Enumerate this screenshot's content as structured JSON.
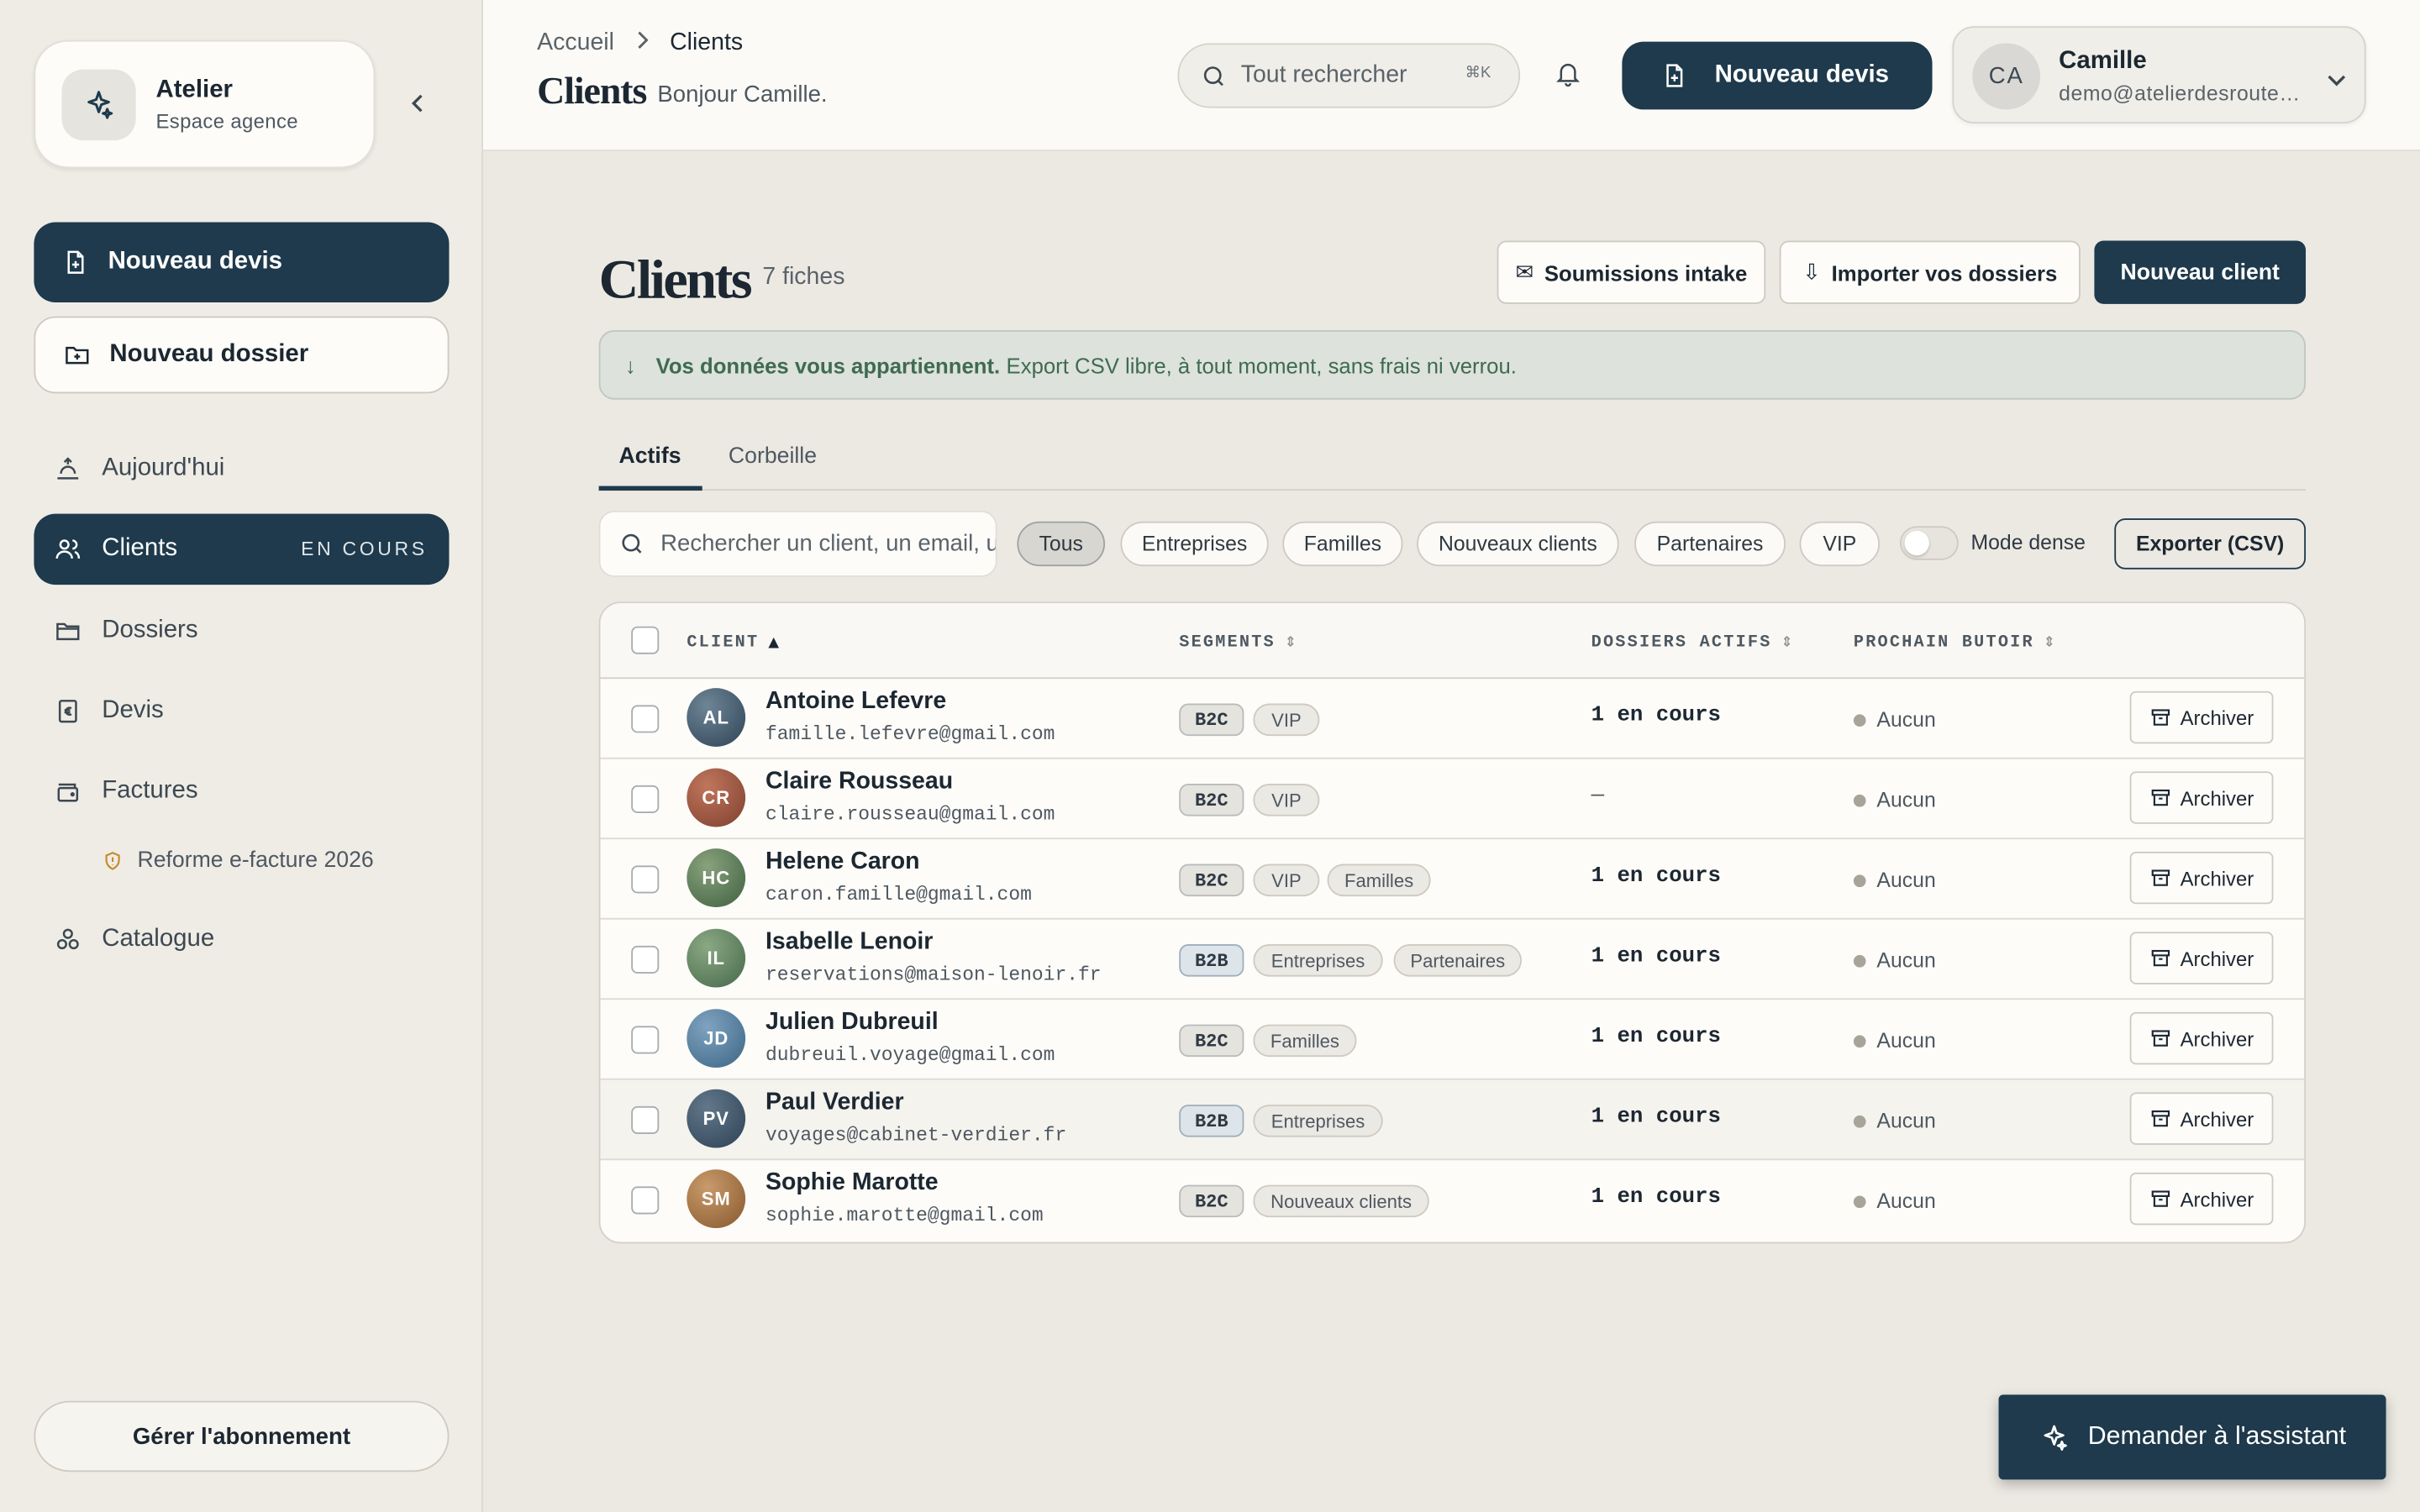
{
  "colors": {
    "accent": "#1e3a4c",
    "notice_bg": "#dde2dc",
    "notice_text": "#3f6b51",
    "background": "#ece9e3"
  },
  "sidebar": {
    "brand_name": "Atelier",
    "brand_sub": "Espace agence",
    "new_quote": "Nouveau devis",
    "new_folder": "Nouveau dossier",
    "nav": {
      "today": "Aujourd'hui",
      "clients": "Clients",
      "clients_badge": "EN COURS",
      "folders": "Dossiers",
      "quotes": "Devis",
      "invoices": "Factures",
      "reform": "Reforme e-facture 2026",
      "catalog": "Catalogue"
    },
    "subscription": "Gérer l'abonnement"
  },
  "header": {
    "crumb_home": "Accueil",
    "crumb_current": "Clients",
    "title": "Clients",
    "greeting": "Bonjour Camille.",
    "search_placeholder": "Tout rechercher",
    "search_shortcut": "⌘K",
    "new_quote": "Nouveau devis",
    "user_initials": "CA",
    "user_name": "Camille",
    "user_email": "demo@atelierdesroutes.fr"
  },
  "main": {
    "title": "Clients",
    "count": "7 fiches",
    "btn_intake": "Soumissions intake",
    "btn_import": "Importer vos dossiers",
    "btn_new_client": "Nouveau client",
    "notice_bold": "Vos données vous appartiennent.",
    "notice_text": "Export CSV libre, à tout moment, sans frais ni verrou.",
    "tabs": {
      "active": "Actifs",
      "trash": "Corbeille"
    },
    "filter_placeholder": "Rechercher un client, un email, un téléphone",
    "chips": [
      "Tous",
      "Entreprises",
      "Familles",
      "Nouveaux clients",
      "Partenaires",
      "VIP"
    ],
    "dense_label": "Mode dense",
    "export": "Exporter (CSV)"
  },
  "table": {
    "headers": {
      "client": "CLIENT",
      "segments": "SEGMENTS",
      "folders": "DOSSIERS ACTIFS",
      "due": "PROCHAIN BUTOIR"
    },
    "archive_label": "Archiver",
    "rows": [
      {
        "initials": "AL",
        "name": "Antoine Lefevre",
        "email": "famille.lefevre@gmail.com",
        "type": "B2C",
        "segments": [
          "VIP"
        ],
        "folders": "1 en cours",
        "due": "Aucun"
      },
      {
        "initials": "CR",
        "name": "Claire Rousseau",
        "email": "claire.rousseau@gmail.com",
        "type": "B2C",
        "segments": [
          "VIP"
        ],
        "folders": "—",
        "due": "Aucun"
      },
      {
        "initials": "HC",
        "name": "Helene Caron",
        "email": "caron.famille@gmail.com",
        "type": "B2C",
        "segments": [
          "VIP",
          "Familles"
        ],
        "folders": "1 en cours",
        "due": "Aucun"
      },
      {
        "initials": "IL",
        "name": "Isabelle Lenoir",
        "email": "reservations@maison-lenoir.fr",
        "type": "B2B",
        "segments": [
          "Entreprises",
          "Partenaires"
        ],
        "folders": "1 en cours",
        "due": "Aucun"
      },
      {
        "initials": "JD",
        "name": "Julien Dubreuil",
        "email": "dubreuil.voyage@gmail.com",
        "type": "B2C",
        "segments": [
          "Familles"
        ],
        "folders": "1 en cours",
        "due": "Aucun"
      },
      {
        "initials": "PV",
        "name": "Paul Verdier",
        "email": "voyages@cabinet-verdier.fr",
        "type": "B2B",
        "segments": [
          "Entreprises"
        ],
        "folders": "1 en cours",
        "due": "Aucun"
      },
      {
        "initials": "SM",
        "name": "Sophie Marotte",
        "email": "sophie.marotte@gmail.com",
        "type": "B2C",
        "segments": [
          "Nouveaux clients"
        ],
        "folders": "1 en cours",
        "due": "Aucun"
      }
    ]
  },
  "assistant": "Demander à l'assistant"
}
